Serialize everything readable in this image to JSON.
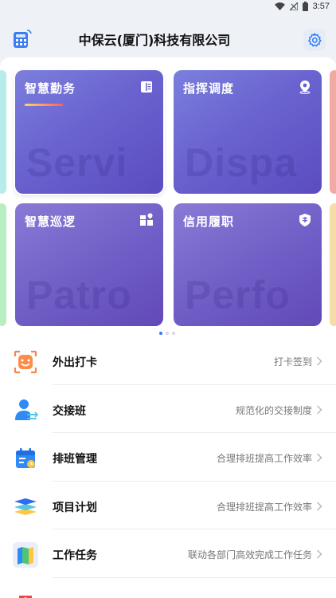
{
  "status_bar": {
    "time": "3:57",
    "icons": [
      "wifi-icon",
      "signal-icon",
      "battery-icon"
    ]
  },
  "header": {
    "title": "中保云(厦门)科技有限公司",
    "left_icon": "calculator-icon",
    "right_icon": "gear-icon"
  },
  "cards": [
    {
      "title": "智慧勤务",
      "watermark": "Servi",
      "icon": "book-icon",
      "selected": true
    },
    {
      "title": "指挥调度",
      "watermark": "Dispa",
      "icon": "location-pin-icon",
      "selected": false
    },
    {
      "title": "智慧巡逻",
      "watermark": "Patro",
      "icon": "grid-pin-icon",
      "selected": false
    },
    {
      "title": "信用履职",
      "watermark": "Perfo",
      "icon": "shield-icon",
      "selected": false
    }
  ],
  "carousel": {
    "active_page": 1,
    "page_count": 3
  },
  "menu": [
    {
      "label": "外出打卡",
      "desc": "打卡签到",
      "icon": "checkin-face-icon"
    },
    {
      "label": "交接班",
      "desc": "规范化的交接制度",
      "icon": "handover-person-icon"
    },
    {
      "label": "排班管理",
      "desc": "合理排班提高工作效率",
      "icon": "calendar-icon"
    },
    {
      "label": "项目计划",
      "desc": "合理排班提高工作效率",
      "icon": "layers-icon"
    },
    {
      "label": "工作任务",
      "desc": "联动各部门高效完成工作任务",
      "icon": "map-icon"
    }
  ],
  "colors": {
    "accent": "#2f7cf6",
    "card": "#6a63cf"
  }
}
